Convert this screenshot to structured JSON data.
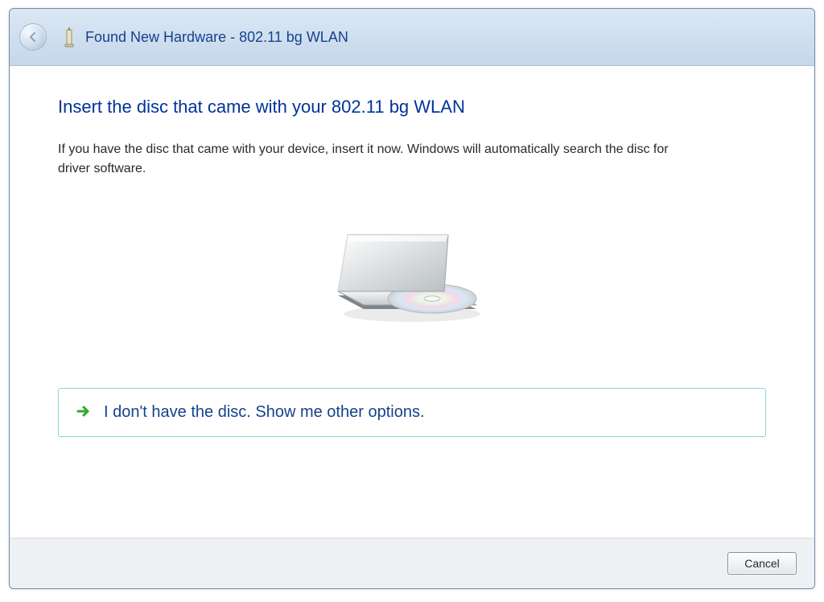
{
  "window": {
    "title": "Found New Hardware - 802.11 bg WLAN"
  },
  "main": {
    "heading": "Insert the disc that came with your 802.11 bg WLAN",
    "body_text": "If you have the disc that came with your device, insert it now.  Windows will automatically search the disc for driver software."
  },
  "option": {
    "no_disc_label": "I don't have the disc.  Show me other options."
  },
  "footer": {
    "cancel_label": "Cancel"
  }
}
